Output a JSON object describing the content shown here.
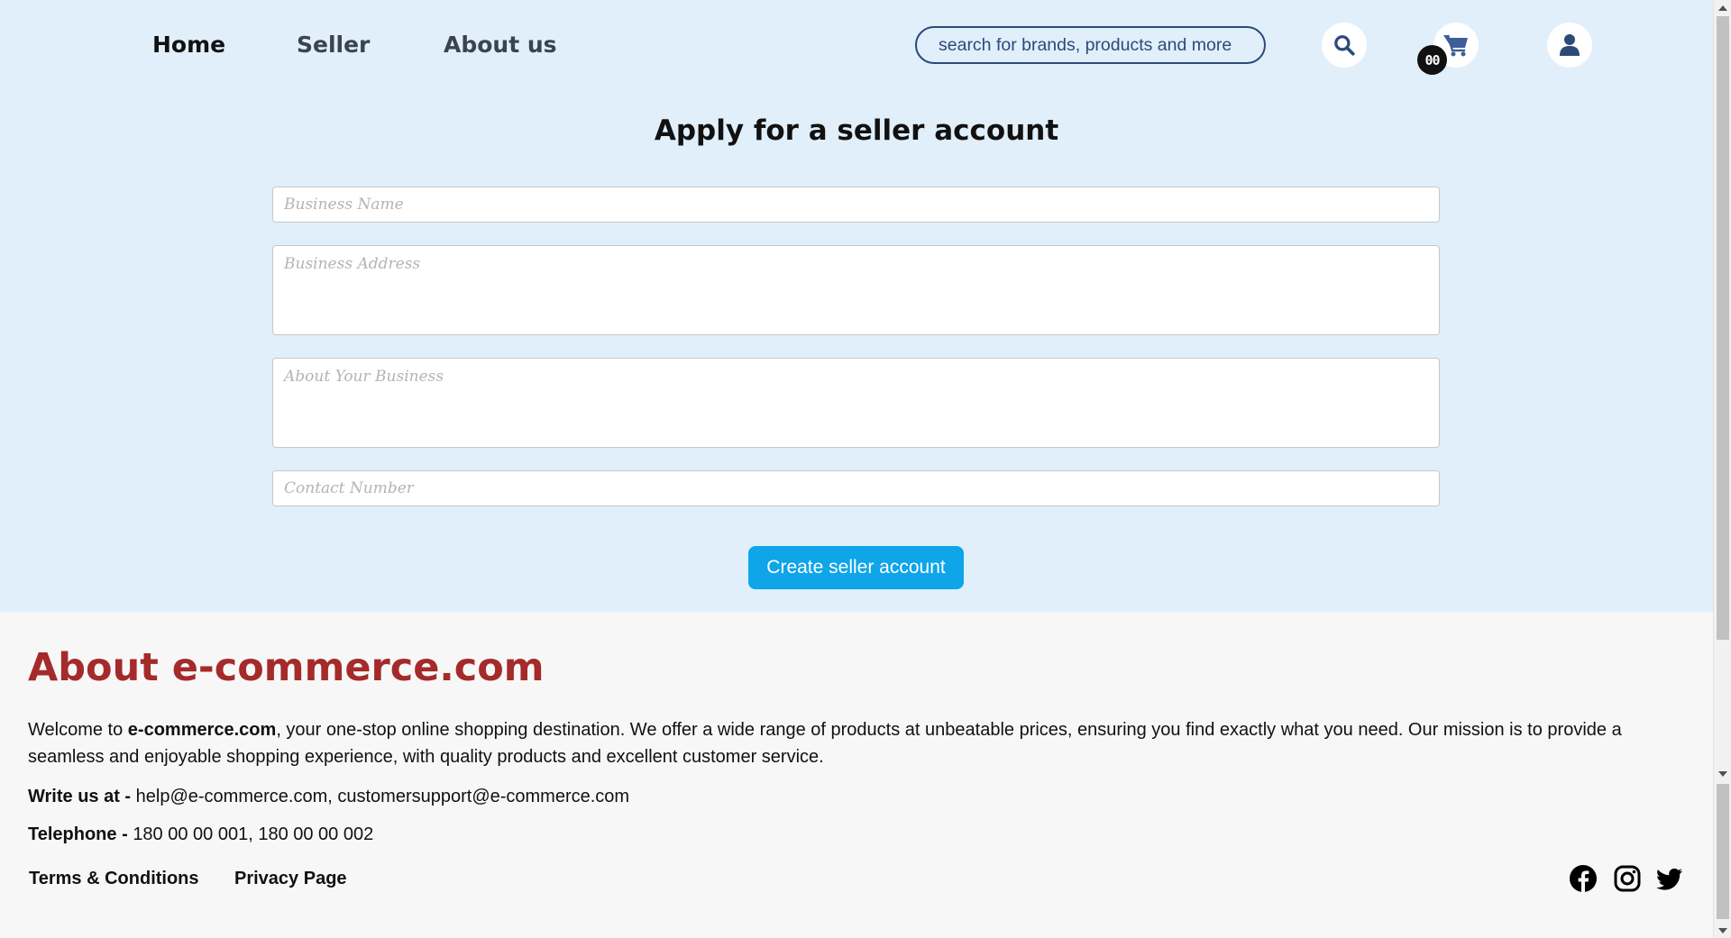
{
  "nav": {
    "home": "Home",
    "seller": "Seller",
    "about": "About us"
  },
  "search": {
    "placeholder": "search for brands, products and more"
  },
  "cart": {
    "count": "00"
  },
  "icons": {
    "search": "search-icon",
    "cart": "cart-icon",
    "user": "user-icon",
    "facebook": "facebook-icon",
    "instagram": "instagram-icon",
    "twitter": "twitter-icon"
  },
  "form": {
    "title": "Apply for a seller account",
    "business_name_placeholder": "Business Name",
    "business_address_placeholder": "Business Address",
    "about_business_placeholder": "About Your Business",
    "contact_number_placeholder": "Contact Number",
    "submit_label": "Create seller account"
  },
  "footer": {
    "title": "About e-commerce.com",
    "intro_prefix": "Welcome to ",
    "intro_brand": "e-commerce.com",
    "intro_rest": ", your one-stop online shopping destination. We offer a wide range of products at unbeatable prices, ensuring you find exactly what you need. Our mission is to provide a seamless and enjoyable shopping experience, with quality products and excellent customer service.",
    "write_label": "Write us at - ",
    "write_value": "help@e-commerce.com, customersupport@e-commerce.com",
    "tel_label": "Telephone - ",
    "tel_value": "180 00 00 001, 180 00 00 002",
    "terms": "Terms & Conditions",
    "privacy": "Privacy Page"
  },
  "colors": {
    "top_bg": "#e1effb",
    "accent_button": "#0ea5e9",
    "footer_title": "#a52a2a",
    "icon_blue": "#2c4a78"
  }
}
